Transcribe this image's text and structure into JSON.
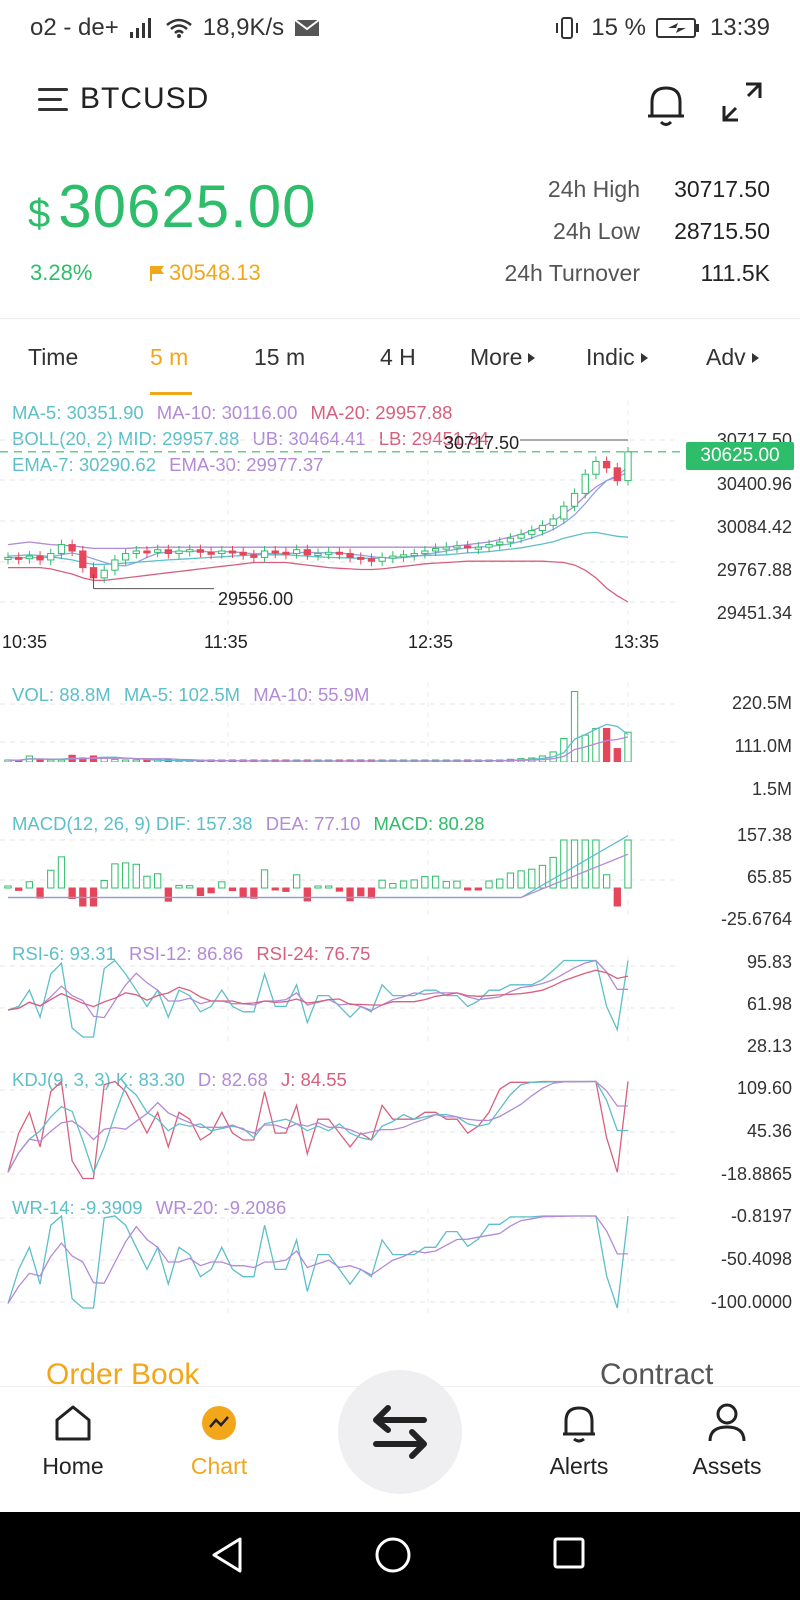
{
  "status_bar": {
    "carrier": "o2 - de+",
    "speed": "18,9K/s",
    "battery": "15 %",
    "time": "13:39"
  },
  "header": {
    "symbol": "BTCUSD",
    "icons": [
      "menu-icon",
      "bell-icon",
      "expand-icon"
    ]
  },
  "price": {
    "currency": "$",
    "last": "30625.00",
    "change_pct": "3.28%",
    "mark_price": "30548.13",
    "stats": [
      {
        "label": "24h High",
        "value": "30717.50"
      },
      {
        "label": "24h Low",
        "value": "28715.50"
      },
      {
        "label": "24h Turnover",
        "value": "111.5K"
      }
    ]
  },
  "tabs": [
    {
      "label": "Time",
      "active": false
    },
    {
      "label": "5 m",
      "active": true
    },
    {
      "label": "15 m",
      "active": false
    },
    {
      "label": "4 H",
      "active": false
    },
    {
      "label": "More",
      "active": false
    },
    {
      "label": "Indic",
      "active": false
    },
    {
      "label": "Adv",
      "active": false
    }
  ],
  "colors": {
    "up": "#2ebd6a",
    "down": "#e5465a",
    "accent": "#f2a71b",
    "teal": "#5dbfc8",
    "purple": "#b38ad6",
    "pink": "#d6607e"
  },
  "main_chart": {
    "legend_row1": {
      "ma5": "MA-5: 30351.90",
      "ma10": "MA-10: 30116.00",
      "ma20": "MA-20: 29957.88"
    },
    "legend_row2": {
      "boll": "BOLL(20, 2) MID: 29957.88",
      "ub": "UB: 30464.41",
      "lb": "LB: 29451.34"
    },
    "legend_row3": {
      "ema7": "EMA-7: 30290.62",
      "ema30": "EMA-30: 29977.37"
    },
    "y_ticks": [
      "30717.50",
      "30400.96",
      "30084.42",
      "29767.88",
      "29451.34"
    ],
    "high_marker": "30717.50",
    "low_marker": "29556.00",
    "last_price_tag": "30625.00",
    "time_ticks": [
      "10:35",
      "11:35",
      "12:35",
      "13:35"
    ]
  },
  "chart_data": [
    {
      "type": "candlestick",
      "title": "BTCUSD 5 m",
      "x": [
        "10:35",
        "11:35",
        "12:35",
        "13:35"
      ],
      "ylim": [
        29451.34,
        30717.5
      ],
      "y_ticks": [
        30717.5,
        30400.96,
        30084.42,
        29767.88,
        29451.34
      ],
      "high": 30717.5,
      "low": 29556.0,
      "last": 30625.0,
      "close_series": [
        29800,
        29790,
        29810,
        29780,
        29830,
        29900,
        29850,
        29720,
        29640,
        29700,
        29780,
        29830,
        29850,
        29840,
        29860,
        29830,
        29850,
        29860,
        29840,
        29830,
        29850,
        29840,
        29820,
        29800,
        29850,
        29840,
        29830,
        29860,
        29820,
        29830,
        29840,
        29830,
        29800,
        29790,
        29770,
        29800,
        29810,
        29820,
        29830,
        29850,
        29870,
        29880,
        29890,
        29880,
        29880,
        29900,
        29920,
        29950,
        29980,
        30010,
        30050,
        30100,
        30200,
        30300,
        30450,
        30550,
        30500,
        30400,
        30625
      ],
      "boll_ub": [
        29900,
        29910,
        29920,
        29910,
        29900,
        29895,
        29890,
        29880,
        29870,
        29870,
        29870,
        29870,
        29875,
        29875,
        29880,
        29880,
        29880,
        29880,
        29880,
        29880,
        29880,
        29880,
        29880,
        29880,
        29880,
        29880,
        29880,
        29880,
        29880,
        29880,
        29880,
        29880,
        29880,
        29880,
        29880,
        29880,
        29880,
        29880,
        29880,
        29880,
        29880,
        29880,
        29890,
        29900,
        29910,
        29920,
        29940,
        29960,
        29980,
        30010,
        30040,
        30080,
        30140,
        30200,
        30280,
        30350,
        30400,
        30430,
        30464
      ],
      "boll_lb": [
        29720,
        29720,
        29720,
        29720,
        29710,
        29690,
        29670,
        29640,
        29620,
        29620,
        29630,
        29640,
        29650,
        29660,
        29670,
        29680,
        29690,
        29700,
        29710,
        29720,
        29730,
        29740,
        29750,
        29760,
        29760,
        29760,
        29760,
        29750,
        29740,
        29730,
        29720,
        29715,
        29710,
        29705,
        29705,
        29710,
        29720,
        29730,
        29740,
        29750,
        29755,
        29760,
        29765,
        29770,
        29770,
        29770,
        29770,
        29770,
        29770,
        29770,
        29770,
        29765,
        29760,
        29740,
        29700,
        29640,
        29560,
        29500,
        29451
      ]
    },
    {
      "type": "bar",
      "title": "VOL",
      "legend": [
        "VOL: 88.8M",
        "MA-5: 102.5M",
        "MA-10: 55.9M"
      ],
      "y_ticks": [
        "220.5M",
        "111.0M",
        "1.5M"
      ],
      "ylim": [
        1.5,
        220.5
      ],
      "values": [
        6,
        4,
        18,
        8,
        6,
        5,
        20,
        12,
        18,
        14,
        8,
        6,
        4,
        5,
        4,
        4,
        3,
        4,
        3,
        3,
        3,
        3,
        3,
        3,
        3,
        3,
        3,
        3,
        3,
        3,
        3,
        3,
        3,
        3,
        3,
        3,
        3,
        3,
        3,
        3,
        3,
        3,
        3,
        4,
        4,
        4,
        6,
        8,
        10,
        12,
        18,
        30,
        70,
        210,
        80,
        100,
        100,
        40,
        88.8
      ]
    },
    {
      "type": "bar",
      "title": "MACD(12, 26, 9)",
      "legend": [
        "MACD(12, 26, 9) DIF: 157.38",
        "DEA: 77.10",
        "MACD: 80.28"
      ],
      "y_ticks": [
        "157.38",
        "65.85",
        "-25.6764"
      ]
    },
    {
      "type": "line",
      "title": "RSI",
      "legend": [
        "RSI-6: 93.31",
        "RSI-12: 86.86",
        "RSI-24: 76.75"
      ],
      "y_ticks": [
        "95.83",
        "61.98",
        "28.13"
      ]
    },
    {
      "type": "line",
      "title": "KDJ(9, 3, 3)",
      "legend": [
        "KDJ(9, 3, 3) K: 83.30",
        "D: 82.68",
        "J: 84.55"
      ],
      "y_ticks": [
        "109.60",
        "45.36",
        "-18.8865"
      ]
    },
    {
      "type": "line",
      "title": "WR",
      "legend": [
        "WR-14: -9.3909",
        "WR-20: -9.2086"
      ],
      "y_ticks": [
        "-0.8197",
        "-50.4098",
        "-100.0000"
      ]
    }
  ],
  "vol": {
    "vol": "VOL: 88.8M",
    "ma5": "MA-5: 102.5M",
    "ma10": "MA-10: 55.9M",
    "y_ticks": [
      "220.5M",
      "111.0M",
      "1.5M"
    ]
  },
  "macd": {
    "dif": "MACD(12, 26, 9) DIF: 157.38",
    "dea": "DEA: 77.10",
    "macd": "MACD: 80.28",
    "y_ticks": [
      "157.38",
      "65.85",
      "-25.6764"
    ]
  },
  "rsi": {
    "rsi6": "RSI-6: 93.31",
    "rsi12": "RSI-12: 86.86",
    "rsi24": "RSI-24: 76.75",
    "y_ticks": [
      "95.83",
      "61.98",
      "28.13"
    ]
  },
  "kdj": {
    "k": "KDJ(9, 3, 3) K: 83.30",
    "d": "D: 82.68",
    "j": "J: 84.55",
    "y_ticks": [
      "109.60",
      "45.36",
      "-18.8865"
    ]
  },
  "wr": {
    "wr14": "WR-14: -9.3909",
    "wr20": "WR-20: -9.2086",
    "y_ticks": [
      "-0.8197",
      "-50.4098",
      "-100.0000"
    ]
  },
  "bottom": {
    "order_book": "Order Book",
    "contract": "Contract"
  },
  "nav": [
    {
      "label": "Home",
      "icon": "home-icon"
    },
    {
      "label": "Chart",
      "icon": "chart-icon"
    },
    {
      "label": "Alerts",
      "icon": "bell-icon"
    },
    {
      "label": "Assets",
      "icon": "user-icon"
    }
  ]
}
